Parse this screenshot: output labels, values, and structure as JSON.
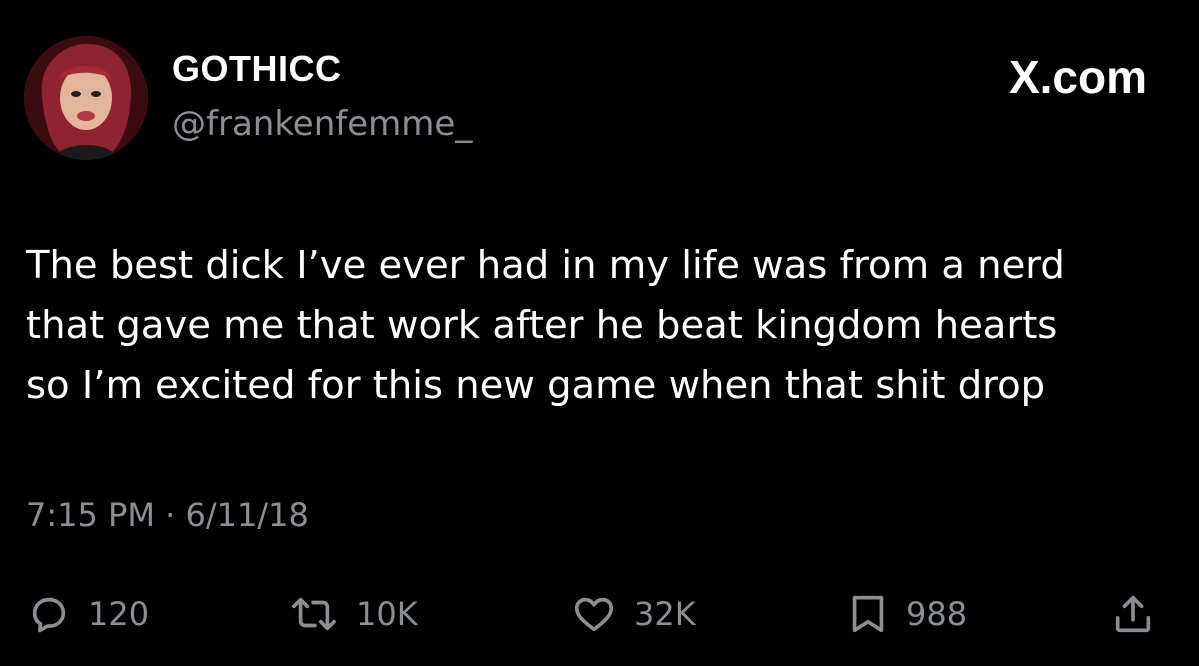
{
  "tweet": {
    "author": {
      "display_name": "GOTHICC",
      "handle": "@frankenfemme_"
    },
    "brand": "X.com",
    "text": "The best dick I’ve ever had in my life was from a nerd\nthat gave me that work after he beat kingdom hearts\nso I’m excited for this new game when that shit drop",
    "timestamp": "7:15 PM · 6/11/18",
    "metrics": {
      "replies": "120",
      "reposts": "10K",
      "likes": "32K",
      "bookmarks": "988"
    },
    "icons": {
      "reply": "reply-bubble-icon",
      "repost": "repost-icon",
      "like": "heart-icon",
      "bookmark": "bookmark-icon",
      "share": "share-icon"
    },
    "colors": {
      "background": "#000000",
      "text": "#ffffff",
      "muted": "#8b8f93"
    }
  }
}
